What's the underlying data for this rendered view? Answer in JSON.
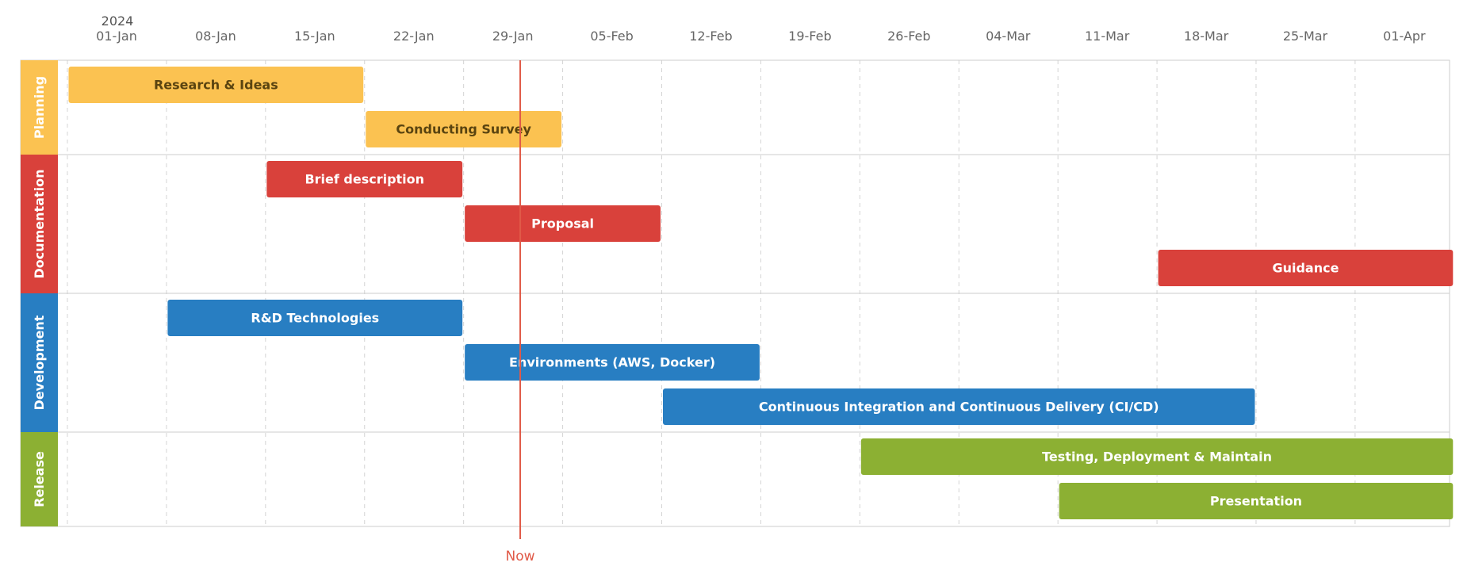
{
  "chart_data": {
    "type": "gantt",
    "year_label": "2024",
    "x_range": [
      "2024-01-01",
      "2024-04-08"
    ],
    "ticks": [
      {
        "date": "2024-01-01",
        "label": "01-Jan"
      },
      {
        "date": "2024-01-08",
        "label": "08-Jan"
      },
      {
        "date": "2024-01-15",
        "label": "15-Jan"
      },
      {
        "date": "2024-01-22",
        "label": "22-Jan"
      },
      {
        "date": "2024-01-29",
        "label": "29-Jan"
      },
      {
        "date": "2024-02-05",
        "label": "05-Feb"
      },
      {
        "date": "2024-02-12",
        "label": "12-Feb"
      },
      {
        "date": "2024-02-19",
        "label": "19-Feb"
      },
      {
        "date": "2024-02-26",
        "label": "26-Feb"
      },
      {
        "date": "2024-03-04",
        "label": "04-Mar"
      },
      {
        "date": "2024-03-11",
        "label": "11-Mar"
      },
      {
        "date": "2024-03-18",
        "label": "18-Mar"
      },
      {
        "date": "2024-03-25",
        "label": "25-Mar"
      },
      {
        "date": "2024-04-01",
        "label": "01-Apr"
      }
    ],
    "grid": true,
    "now": {
      "label": "Now",
      "date": "2024-02-02",
      "color": "#e05a48"
    },
    "groups": [
      {
        "name": "Planning",
        "color": "#fbc251",
        "text_color": "#5a4410",
        "tasks": [
          {
            "name": "Research & Ideas",
            "start": "2024-01-01",
            "end": "2024-01-22"
          },
          {
            "name": "Conducting Survey",
            "start": "2024-01-22",
            "end": "2024-02-05"
          }
        ]
      },
      {
        "name": "Documentation",
        "color": "#d9413b",
        "text_color": "#ffffff",
        "tasks": [
          {
            "name": "Brief description",
            "start": "2024-01-15",
            "end": "2024-01-29"
          },
          {
            "name": "Proposal",
            "start": "2024-01-29",
            "end": "2024-02-12"
          },
          {
            "name": "Guidance",
            "start": "2024-03-18",
            "end": "2024-04-08"
          }
        ]
      },
      {
        "name": "Development",
        "color": "#287ec2",
        "text_color": "#ffffff",
        "tasks": [
          {
            "name": "R&D Technologies",
            "start": "2024-01-08",
            "end": "2024-01-29"
          },
          {
            "name": "Environments (AWS, Docker)",
            "start": "2024-01-29",
            "end": "2024-02-19"
          },
          {
            "name": "Continuous Integration and Continuous Delivery (CI/CD)",
            "start": "2024-02-12",
            "end": "2024-03-25"
          }
        ]
      },
      {
        "name": "Release",
        "color": "#8cb033",
        "text_color": "#ffffff",
        "tasks": [
          {
            "name": "Testing, Deployment & Maintain",
            "start": "2024-02-26",
            "end": "2024-04-08"
          },
          {
            "name": "Presentation",
            "start": "2024-03-11",
            "end": "2024-04-08"
          }
        ]
      }
    ]
  }
}
